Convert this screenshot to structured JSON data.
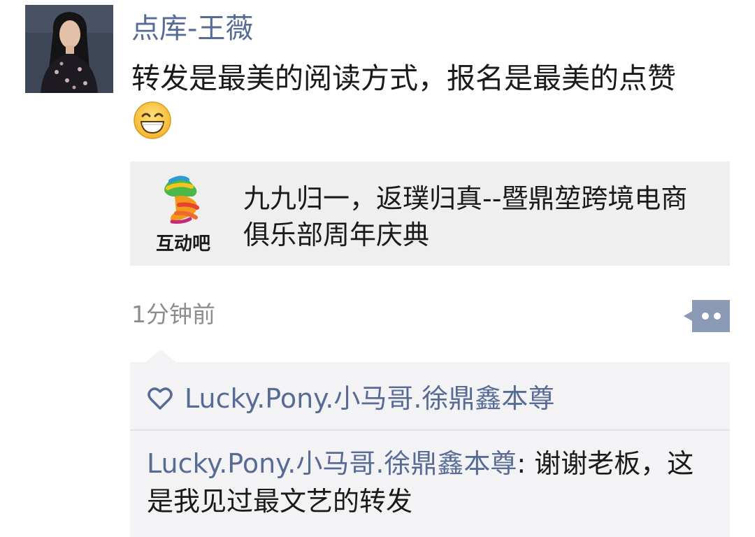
{
  "post": {
    "author": "点库-王薇",
    "text": "转发是最美的阅读方式，报名是最美的点赞",
    "emoji": "grinning-face-emoji",
    "share": {
      "logo_icon": "hudongba-hands-logo",
      "logo_label": "互动吧",
      "title": "九九归一，返璞归真--暨鼎堃跨境电商俱乐部周年庆典"
    },
    "timestamp": "1分钟前",
    "more_icon": "more-dots-icon"
  },
  "interactions": {
    "like_icon": "heart-icon",
    "likers": "Lucky.Pony.小马哥.徐鼎鑫本尊",
    "comments": [
      {
        "author": "Lucky.Pony.小马哥.徐鼎鑫本尊",
        "separator": ": ",
        "text": "谢谢老板，这是我见过最文艺的转发"
      }
    ]
  },
  "colors": {
    "link_blue": "#576b95",
    "panel_bg": "#f3f3f5",
    "card_bg": "#efefef",
    "timestamp_gray": "#8c8c8c"
  }
}
